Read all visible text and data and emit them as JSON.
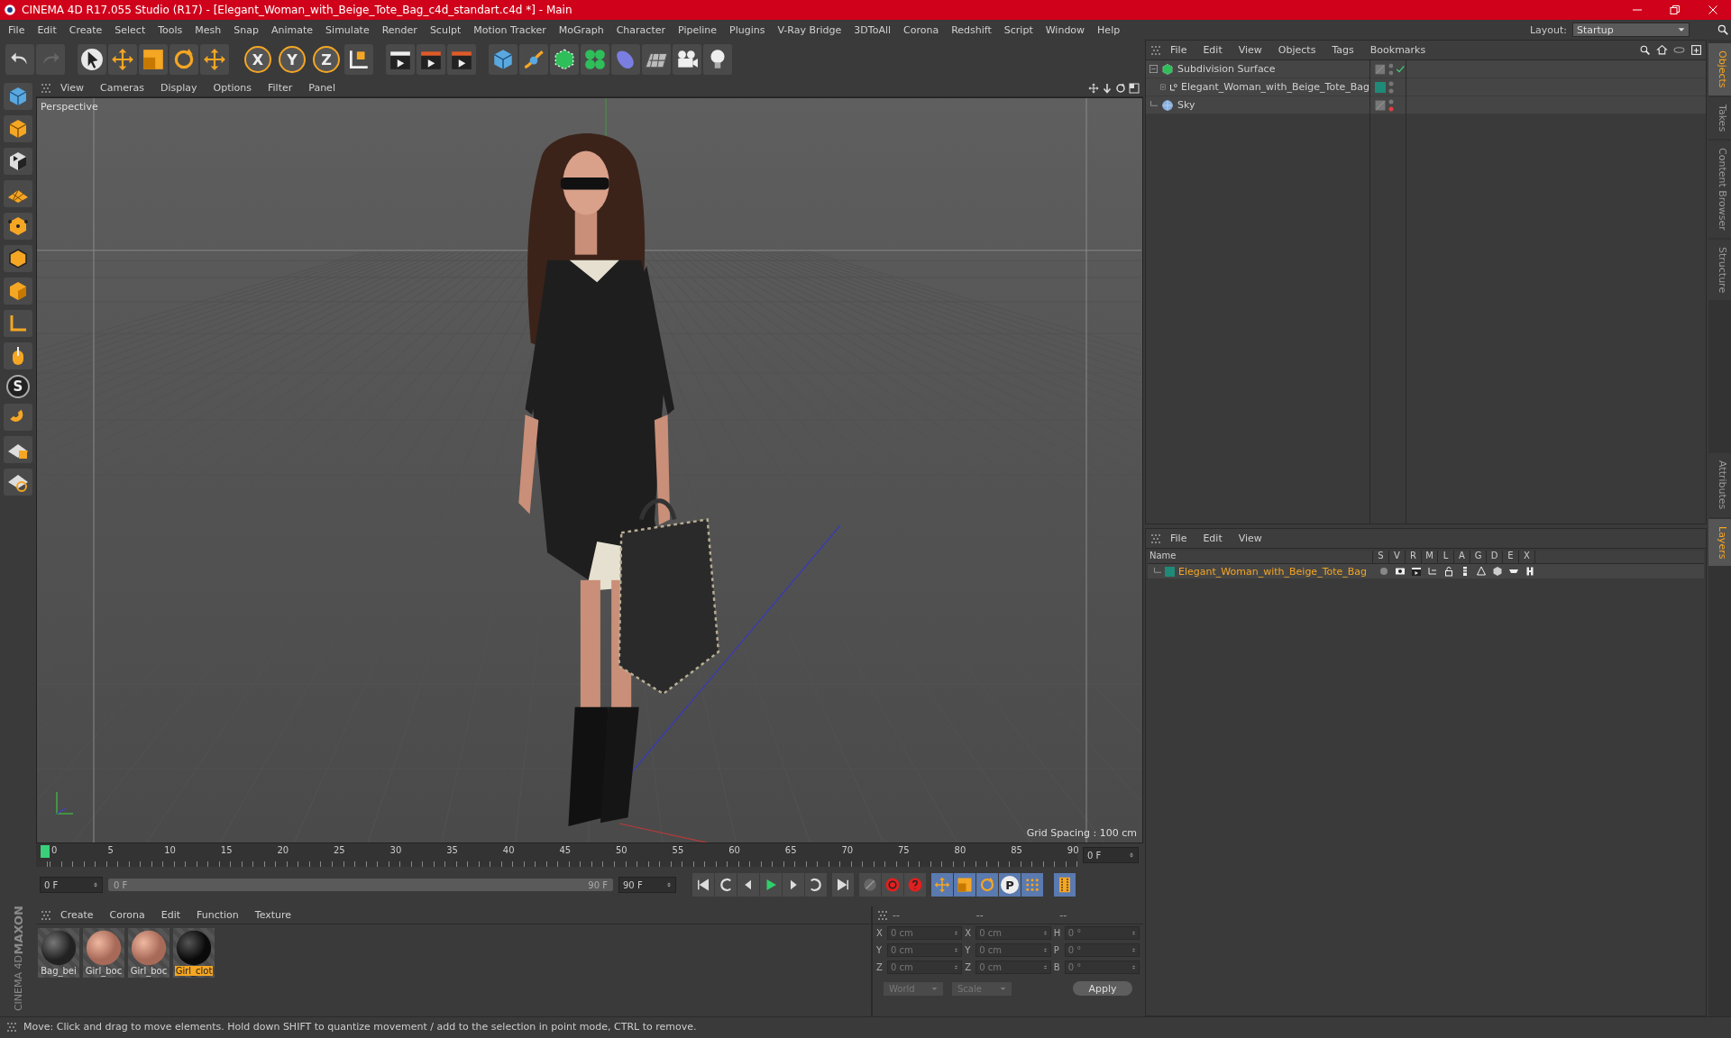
{
  "window": {
    "title": "CINEMA 4D R17.055 Studio (R17) - [Elegant_Woman_with_Beige_Tote_Bag_c4d_standart.c4d *] - Main"
  },
  "menu": [
    "File",
    "Edit",
    "Create",
    "Select",
    "Tools",
    "Mesh",
    "Snap",
    "Animate",
    "Simulate",
    "Render",
    "Sculpt",
    "Motion Tracker",
    "MoGraph",
    "Character",
    "Pipeline",
    "Plugins",
    "V-Ray Bridge",
    "3DToAll",
    "Corona",
    "Redshift",
    "Script",
    "Window",
    "Help"
  ],
  "layout": {
    "label": "Layout:",
    "value": "Startup"
  },
  "toolbar": {
    "axis_buttons": [
      "X",
      "Y",
      "Z"
    ]
  },
  "left_tools": {
    "snap_label": "S"
  },
  "logo": {
    "line1": "MAXON",
    "line2": "CINEMA 4D"
  },
  "viewport": {
    "menu": [
      "View",
      "Cameras",
      "Display",
      "Options",
      "Filter",
      "Panel"
    ],
    "camera": "Perspective",
    "grid_spacing": "Grid Spacing : 100 cm"
  },
  "object_manager": {
    "menu": [
      "File",
      "Edit",
      "View",
      "Objects",
      "Tags",
      "Bookmarks"
    ],
    "objects": [
      {
        "name": "Subdivision Surface",
        "kind": "subdivision",
        "check": true,
        "render_off": false,
        "children": [
          {
            "name": "Elegant_Woman_with_Beige_Tote_Bag",
            "kind": "null",
            "color": "#1f8a78",
            "check": false,
            "render_off": false
          }
        ]
      },
      {
        "name": "Sky",
        "kind": "sky",
        "check": false,
        "render_off": true
      }
    ]
  },
  "layer_manager": {
    "menu": [
      "File",
      "Edit",
      "View"
    ],
    "columns": [
      "Name",
      "S",
      "V",
      "R",
      "M",
      "L",
      "A",
      "G",
      "D",
      "E",
      "X"
    ],
    "rows": [
      {
        "name": "Elegant_Woman_with_Beige_Tote_Bag",
        "color": "#1f8a78"
      }
    ]
  },
  "side_tabs": [
    {
      "label": "Objects",
      "selected": true
    },
    {
      "label": "Takes",
      "selected": false
    },
    {
      "label": "Content Browser",
      "selected": false
    },
    {
      "label": "Structure",
      "selected": false
    }
  ],
  "side_tabs_lower": [
    {
      "label": "Attributes",
      "selected": false
    },
    {
      "label": "Layers",
      "selected": true
    }
  ],
  "timeline": {
    "ticks": [
      "0",
      "5",
      "10",
      "15",
      "20",
      "25",
      "30",
      "35",
      "40",
      "45",
      "50",
      "55",
      "60",
      "65",
      "70",
      "75",
      "80",
      "85",
      "90"
    ],
    "current_frame": "0 F",
    "start_field": "0 F",
    "range_start": "0 F",
    "range_end": "90 F",
    "range_slider": {
      "level": 1
    },
    "end_field": "90 F",
    "key_label": "P"
  },
  "materials": {
    "menu": [
      "Create",
      "Corona",
      "Edit",
      "Function",
      "Texture"
    ],
    "items": [
      {
        "name": "Bag_bei",
        "kind": "pattern",
        "selected": false
      },
      {
        "name": "Girl_boc",
        "kind": "skin",
        "selected": false
      },
      {
        "name": "Girl_boc",
        "kind": "skin",
        "selected": false
      },
      {
        "name": "Girl_clot",
        "kind": "dark",
        "selected": true
      }
    ]
  },
  "coordinates": {
    "headers": [
      "--",
      "--",
      "--"
    ],
    "rows": [
      {
        "axis": "X",
        "position": "0 cm",
        "size_axis": "X",
        "size": "0 cm",
        "rot_axis": "H",
        "rotation": "0 °"
      },
      {
        "axis": "Y",
        "position": "0 cm",
        "size_axis": "Y",
        "size": "0 cm",
        "rot_axis": "P",
        "rotation": "0 °"
      },
      {
        "axis": "Z",
        "position": "0 cm",
        "size_axis": "Z",
        "size": "0 cm",
        "rot_axis": "B",
        "rotation": "0 °"
      }
    ],
    "mode": "World",
    "scale": "Scale",
    "apply": "Apply"
  },
  "status": "Move: Click and drag to move elements. Hold down SHIFT to quantize movement / add to the selection in point mode, CTRL to remove."
}
